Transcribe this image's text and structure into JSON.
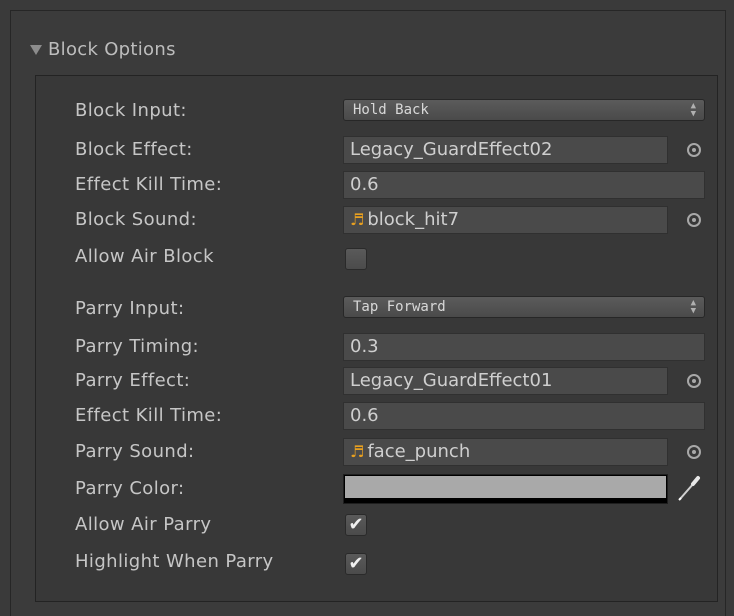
{
  "section": {
    "title": "Block Options"
  },
  "block": {
    "input_label": "Block Input:",
    "input_value": "Hold Back",
    "effect_label": "Block Effect:",
    "effect_value": "Legacy_GuardEffect02",
    "kill_time_label": "Effect Kill Time:",
    "kill_time_value": "0.6",
    "sound_label": "Block Sound:",
    "sound_value": "block_hit7",
    "air_label": "Allow Air Block",
    "air_checked": false
  },
  "parry": {
    "input_label": "Parry Input:",
    "input_value": "Tap Forward",
    "timing_label": "Parry Timing:",
    "timing_value": "0.3",
    "effect_label": "Parry Effect:",
    "effect_value": "Legacy_GuardEffect01",
    "kill_time_label": "Effect Kill Time:",
    "kill_time_value": "0.6",
    "sound_label": "Parry Sound:",
    "sound_value": "face_punch",
    "color_label": "Parry Color:",
    "color_value": "#a9a9a9",
    "air_label": "Allow Air Parry",
    "air_checked": true,
    "highlight_label": "Highlight When Parry",
    "highlight_checked": true
  },
  "icons": {
    "foldout": "triangle-down-icon",
    "object_picker": "target-circle-icon",
    "audio": "audio-clip-icon",
    "eyedropper": "eyedropper-icon",
    "checkmark": "✔"
  }
}
